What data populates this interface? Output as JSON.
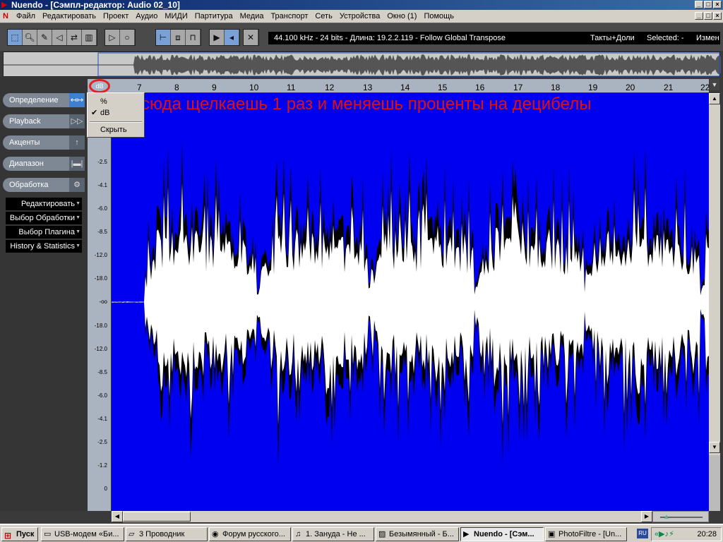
{
  "window": {
    "title": "Nuendo - [Сэмпл-редактор: Audio 02_10]",
    "min": "_",
    "max": "□",
    "close": "×"
  },
  "menu": [
    "Файл",
    "Редактировать",
    "Проект",
    "Аудио",
    "МИДИ",
    "Партитура",
    "Медиа",
    "Транспорт",
    "Сеть",
    "Устройства",
    "Окно (1)",
    "Помощь"
  ],
  "toolbar": {
    "info": "44.100 kHz - 24 bits - Длина: 19.2.2.119 - Follow Global Transpose",
    "timebase": "Такты+Доли",
    "selected": "Selected: -",
    "edit": "Измен"
  },
  "ruler": {
    "unit_button": "dB",
    "bars": [
      7,
      8,
      9,
      10,
      11,
      12,
      13,
      14,
      15,
      16,
      17,
      18,
      19,
      20,
      21,
      22
    ]
  },
  "inspector": {
    "tabs": [
      {
        "label": "Определение",
        "icon": "↤↦"
      },
      {
        "label": "Playback",
        "icon": "▷▷"
      },
      {
        "label": "Акценты",
        "icon": "↑"
      },
      {
        "label": "Диапазон",
        "icon": "|▬|"
      },
      {
        "label": "Обработка",
        "icon": "⚙"
      }
    ],
    "submenus": [
      "Редактировать",
      "Выбор Обработки",
      "Выбор Плагина",
      "History & Statistics"
    ]
  },
  "scale_labels": [
    "-2.5",
    "-4.1",
    "-6.0",
    "-8.5",
    "-12.0",
    "-18.0",
    "-oo",
    "-18.0",
    "-12.0",
    "-8.5",
    "-6.0",
    "-4.1",
    "-2.5",
    "-1.2",
    "0"
  ],
  "annotation": "сюда щелкаешь 1 раз и меняешь проценты на децибелы",
  "context_menu": {
    "items": [
      {
        "label": "%",
        "checked": false
      },
      {
        "label": "dB",
        "checked": true
      },
      {
        "label": "Скрыть",
        "checked": false
      }
    ],
    "checkmark": "✔"
  },
  "colors": {
    "waveform_bg": "#0000f0",
    "waveform_fill": "#ffffff",
    "annotation": "#e01010",
    "highlight_ring": "#e52020"
  },
  "taskbar": {
    "start": "Пуск",
    "tasks": [
      {
        "label": "USB-модем «Би...",
        "active": false
      },
      {
        "label": "3 Проводник",
        "active": false
      },
      {
        "label": "Форум русского...",
        "active": false
      },
      {
        "label": "1. Зануда - Не ...",
        "active": false
      },
      {
        "label": "Безымянный - Б...",
        "active": false
      },
      {
        "label": "Nuendo - [Сэм...",
        "active": true
      },
      {
        "label": "PhotoFiltre - [Un...",
        "active": false
      }
    ],
    "lang": "RU",
    "clock": "20:28"
  }
}
